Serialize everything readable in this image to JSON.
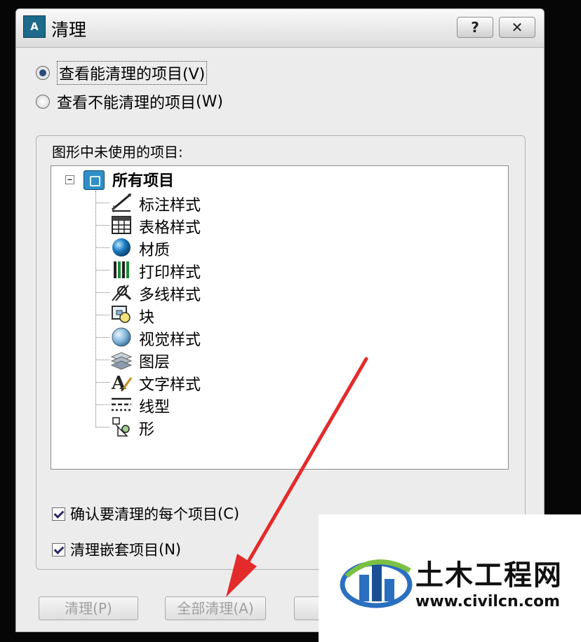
{
  "window": {
    "title": "清理",
    "app_icon_text": "A",
    "help_label": "?",
    "close_label": "✕"
  },
  "view_options": {
    "purgeable": {
      "label": "查看能清理的项目",
      "shortcut": "(V)",
      "selected": true
    },
    "non_purgeable": {
      "label": "查看不能清理的项目",
      "shortcut": "(W)",
      "selected": false
    }
  },
  "unused_group": {
    "label": "图形中未使用的项目:",
    "tree": {
      "root_label": "所有项目",
      "expander": "⊟",
      "items": [
        {
          "label": "标注样式",
          "icon": "dimension-style-icon"
        },
        {
          "label": "表格样式",
          "icon": "table-style-icon"
        },
        {
          "label": "材质",
          "icon": "material-icon"
        },
        {
          "label": "打印样式",
          "icon": "plot-style-icon"
        },
        {
          "label": "多线样式",
          "icon": "multiline-style-icon"
        },
        {
          "label": "块",
          "icon": "block-icon"
        },
        {
          "label": "视觉样式",
          "icon": "visual-style-icon"
        },
        {
          "label": "图层",
          "icon": "layer-icon"
        },
        {
          "label": "文字样式",
          "icon": "text-style-icon"
        },
        {
          "label": "线型",
          "icon": "linetype-icon"
        },
        {
          "label": "形",
          "icon": "shape-icon"
        }
      ]
    },
    "confirm_each": {
      "label": "确认要清理的每个项目",
      "shortcut": "(C)",
      "checked": true
    },
    "purge_nested": {
      "label": "清理嵌套项目",
      "shortcut": "(N)",
      "checked": true
    }
  },
  "buttons": {
    "purge": "清理(P)",
    "purge_all": "全部清理(A)"
  },
  "watermark": {
    "name": "土木工程网",
    "url": "www.civilcn.com"
  },
  "colors": {
    "dialog_bg": "#ececec",
    "annotation_arrow": "#e32b2b",
    "tree_icon_blue": "#2f8fc8"
  }
}
